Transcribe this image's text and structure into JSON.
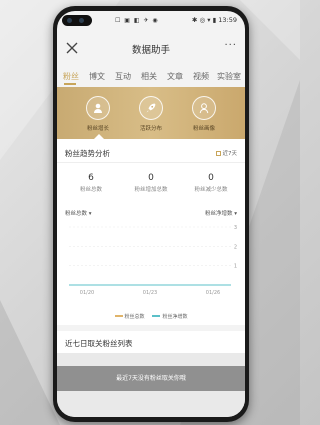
{
  "status_bar": {
    "left_icons": "☐ ▣ ◧ ✈ ◉",
    "right": "✱ ◎ ▾ ▮ 13:59"
  },
  "header": {
    "title": "数据助手",
    "more": "···"
  },
  "tabs": [
    {
      "label": "粉丝",
      "active": true
    },
    {
      "label": "博文"
    },
    {
      "label": "互动"
    },
    {
      "label": "相关"
    },
    {
      "label": "文章"
    },
    {
      "label": "视频"
    },
    {
      "label": "实验室"
    }
  ],
  "hero": [
    {
      "label": "粉丝增长",
      "icon": "user-chart-icon"
    },
    {
      "label": "活跃分布",
      "icon": "rocket-icon"
    },
    {
      "label": "粉丝画像",
      "icon": "person-icon"
    }
  ],
  "trend": {
    "title": "粉丝趋势分析",
    "range": "近7天",
    "stats": [
      {
        "value": "6",
        "label": "粉丝总数"
      },
      {
        "value": "0",
        "label": "粉丝增加总数"
      },
      {
        "value": "0",
        "label": "粉丝减少总数"
      }
    ],
    "left_select": "粉丝总数",
    "right_select": "粉丝净增数"
  },
  "chart_data": {
    "type": "line",
    "series": [
      {
        "name": "粉丝总数",
        "color": "#e0b46a",
        "values": [
          6,
          6,
          6,
          6,
          6,
          6,
          6
        ]
      },
      {
        "name": "粉丝净增数",
        "color": "#5bc0c8",
        "values": [
          0,
          0,
          0,
          0,
          0,
          0,
          0
        ]
      }
    ],
    "x_tick_labels": [
      "01/20",
      "01/23",
      "01/26"
    ],
    "right_axis_ticks": [
      "3",
      "2",
      "1"
    ],
    "grid": true,
    "legend": "bottom"
  },
  "list": {
    "title": "近七日取关粉丝列表"
  },
  "toast": {
    "message": "最近7天没有粉丝取关你哦"
  },
  "colors": {
    "accent": "#c8a55a",
    "hero_gold": "#d3b37b"
  }
}
